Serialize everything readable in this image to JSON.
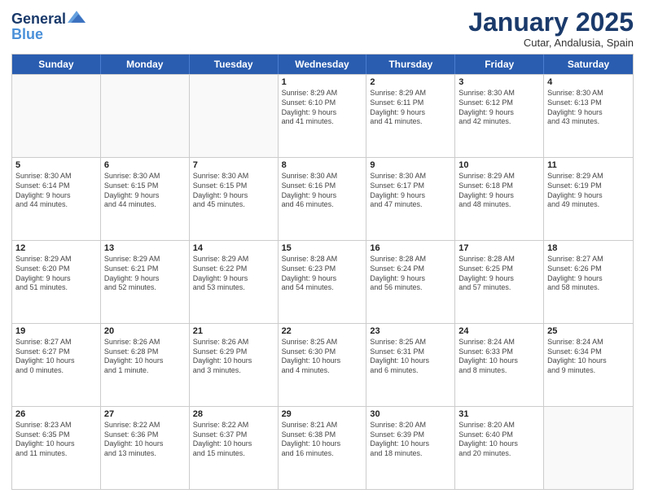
{
  "header": {
    "logo_line1": "General",
    "logo_line2": "Blue",
    "month": "January 2025",
    "location": "Cutar, Andalusia, Spain"
  },
  "weekdays": [
    "Sunday",
    "Monday",
    "Tuesday",
    "Wednesday",
    "Thursday",
    "Friday",
    "Saturday"
  ],
  "rows": [
    [
      {
        "day": "",
        "info": ""
      },
      {
        "day": "",
        "info": ""
      },
      {
        "day": "",
        "info": ""
      },
      {
        "day": "1",
        "info": "Sunrise: 8:29 AM\nSunset: 6:10 PM\nDaylight: 9 hours\nand 41 minutes."
      },
      {
        "day": "2",
        "info": "Sunrise: 8:29 AM\nSunset: 6:11 PM\nDaylight: 9 hours\nand 41 minutes."
      },
      {
        "day": "3",
        "info": "Sunrise: 8:30 AM\nSunset: 6:12 PM\nDaylight: 9 hours\nand 42 minutes."
      },
      {
        "day": "4",
        "info": "Sunrise: 8:30 AM\nSunset: 6:13 PM\nDaylight: 9 hours\nand 43 minutes."
      }
    ],
    [
      {
        "day": "5",
        "info": "Sunrise: 8:30 AM\nSunset: 6:14 PM\nDaylight: 9 hours\nand 44 minutes."
      },
      {
        "day": "6",
        "info": "Sunrise: 8:30 AM\nSunset: 6:15 PM\nDaylight: 9 hours\nand 44 minutes."
      },
      {
        "day": "7",
        "info": "Sunrise: 8:30 AM\nSunset: 6:15 PM\nDaylight: 9 hours\nand 45 minutes."
      },
      {
        "day": "8",
        "info": "Sunrise: 8:30 AM\nSunset: 6:16 PM\nDaylight: 9 hours\nand 46 minutes."
      },
      {
        "day": "9",
        "info": "Sunrise: 8:30 AM\nSunset: 6:17 PM\nDaylight: 9 hours\nand 47 minutes."
      },
      {
        "day": "10",
        "info": "Sunrise: 8:29 AM\nSunset: 6:18 PM\nDaylight: 9 hours\nand 48 minutes."
      },
      {
        "day": "11",
        "info": "Sunrise: 8:29 AM\nSunset: 6:19 PM\nDaylight: 9 hours\nand 49 minutes."
      }
    ],
    [
      {
        "day": "12",
        "info": "Sunrise: 8:29 AM\nSunset: 6:20 PM\nDaylight: 9 hours\nand 51 minutes."
      },
      {
        "day": "13",
        "info": "Sunrise: 8:29 AM\nSunset: 6:21 PM\nDaylight: 9 hours\nand 52 minutes."
      },
      {
        "day": "14",
        "info": "Sunrise: 8:29 AM\nSunset: 6:22 PM\nDaylight: 9 hours\nand 53 minutes."
      },
      {
        "day": "15",
        "info": "Sunrise: 8:28 AM\nSunset: 6:23 PM\nDaylight: 9 hours\nand 54 minutes."
      },
      {
        "day": "16",
        "info": "Sunrise: 8:28 AM\nSunset: 6:24 PM\nDaylight: 9 hours\nand 56 minutes."
      },
      {
        "day": "17",
        "info": "Sunrise: 8:28 AM\nSunset: 6:25 PM\nDaylight: 9 hours\nand 57 minutes."
      },
      {
        "day": "18",
        "info": "Sunrise: 8:27 AM\nSunset: 6:26 PM\nDaylight: 9 hours\nand 58 minutes."
      }
    ],
    [
      {
        "day": "19",
        "info": "Sunrise: 8:27 AM\nSunset: 6:27 PM\nDaylight: 10 hours\nand 0 minutes."
      },
      {
        "day": "20",
        "info": "Sunrise: 8:26 AM\nSunset: 6:28 PM\nDaylight: 10 hours\nand 1 minute."
      },
      {
        "day": "21",
        "info": "Sunrise: 8:26 AM\nSunset: 6:29 PM\nDaylight: 10 hours\nand 3 minutes."
      },
      {
        "day": "22",
        "info": "Sunrise: 8:25 AM\nSunset: 6:30 PM\nDaylight: 10 hours\nand 4 minutes."
      },
      {
        "day": "23",
        "info": "Sunrise: 8:25 AM\nSunset: 6:31 PM\nDaylight: 10 hours\nand 6 minutes."
      },
      {
        "day": "24",
        "info": "Sunrise: 8:24 AM\nSunset: 6:33 PM\nDaylight: 10 hours\nand 8 minutes."
      },
      {
        "day": "25",
        "info": "Sunrise: 8:24 AM\nSunset: 6:34 PM\nDaylight: 10 hours\nand 9 minutes."
      }
    ],
    [
      {
        "day": "26",
        "info": "Sunrise: 8:23 AM\nSunset: 6:35 PM\nDaylight: 10 hours\nand 11 minutes."
      },
      {
        "day": "27",
        "info": "Sunrise: 8:22 AM\nSunset: 6:36 PM\nDaylight: 10 hours\nand 13 minutes."
      },
      {
        "day": "28",
        "info": "Sunrise: 8:22 AM\nSunset: 6:37 PM\nDaylight: 10 hours\nand 15 minutes."
      },
      {
        "day": "29",
        "info": "Sunrise: 8:21 AM\nSunset: 6:38 PM\nDaylight: 10 hours\nand 16 minutes."
      },
      {
        "day": "30",
        "info": "Sunrise: 8:20 AM\nSunset: 6:39 PM\nDaylight: 10 hours\nand 18 minutes."
      },
      {
        "day": "31",
        "info": "Sunrise: 8:20 AM\nSunset: 6:40 PM\nDaylight: 10 hours\nand 20 minutes."
      },
      {
        "day": "",
        "info": ""
      }
    ]
  ]
}
